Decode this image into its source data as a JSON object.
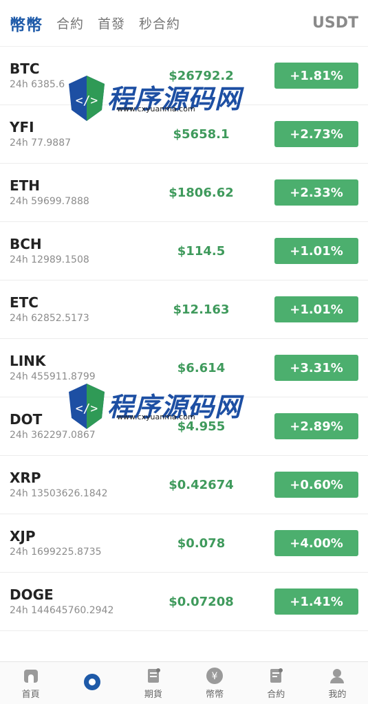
{
  "header": {
    "tabs": [
      {
        "label": "幣幣",
        "active": true
      },
      {
        "label": "合約",
        "active": false
      },
      {
        "label": "首發",
        "active": false
      },
      {
        "label": "秒合約",
        "active": false
      }
    ],
    "currency": "USDT"
  },
  "coins": [
    {
      "name": "BTC",
      "vol": "24h 6385.6",
      "price": "$26792.2",
      "change": "+1.81%"
    },
    {
      "name": "YFI",
      "vol": "24h 77.9887",
      "price": "$5658.1",
      "change": "+2.73%"
    },
    {
      "name": "ETH",
      "vol": "24h 59699.7888",
      "price": "$1806.62",
      "change": "+2.33%"
    },
    {
      "name": "BCH",
      "vol": "24h 12989.1508",
      "price": "$114.5",
      "change": "+1.01%"
    },
    {
      "name": "ETC",
      "vol": "24h 62852.5173",
      "price": "$12.163",
      "change": "+1.01%"
    },
    {
      "name": "LINK",
      "vol": "24h 455911.8799",
      "price": "$6.614",
      "change": "+3.31%"
    },
    {
      "name": "DOT",
      "vol": "24h 362297.0867",
      "price": "$4.955",
      "change": "+2.89%"
    },
    {
      "name": "XRP",
      "vol": "24h 13503626.1842",
      "price": "$0.42674",
      "change": "+0.60%"
    },
    {
      "name": "XJP",
      "vol": "24h 1699225.8735",
      "price": "$0.078",
      "change": "+4.00%"
    },
    {
      "name": "DOGE",
      "vol": "24h 144645760.2942",
      "price": "$0.07208",
      "change": "+1.41%"
    }
  ],
  "colors": {
    "accent": "#1e5aa8",
    "up": "#4caf6e",
    "price": "#3f9a5c"
  },
  "nav": [
    {
      "label": "首頁",
      "icon": "home-icon"
    },
    {
      "label": "",
      "icon": "market-icon"
    },
    {
      "label": "期貨",
      "icon": "futures-icon"
    },
    {
      "label": "幣幣",
      "icon": "coin-icon"
    },
    {
      "label": "合約",
      "icon": "contract-icon"
    },
    {
      "label": "我的",
      "icon": "user-icon"
    }
  ],
  "watermark": {
    "text": "程序源码网",
    "url": "www.cxyuanma.com"
  }
}
